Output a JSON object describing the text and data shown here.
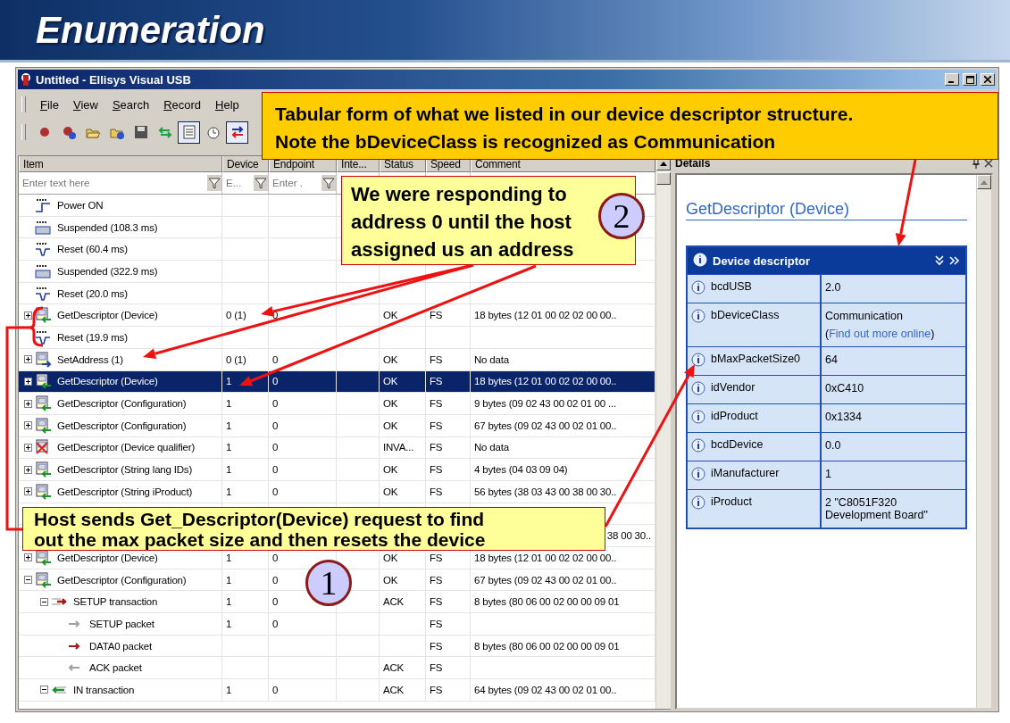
{
  "slide_title": "Enumeration",
  "window": {
    "title": "Untitled - Ellisys Visual USB"
  },
  "menu": [
    "File",
    "View",
    "Search",
    "Record",
    "Help"
  ],
  "toolbar": [
    {
      "kind": "record",
      "on": false
    },
    {
      "kind": "record-add",
      "on": false
    },
    {
      "kind": "open",
      "on": false
    },
    {
      "kind": "open-add",
      "on": false
    },
    {
      "kind": "save",
      "on": false
    },
    {
      "kind": "swap",
      "on": false
    },
    {
      "kind": "details",
      "on": true
    },
    {
      "kind": "clock",
      "on": false
    },
    {
      "kind": "exchange",
      "on": true
    }
  ],
  "table": {
    "columns": [
      "Item",
      "Device",
      "Endpoint",
      "Inte...",
      "Status",
      "Speed",
      "Comment"
    ],
    "filters": [
      {
        "placeholder": "Enter text here"
      },
      {
        "placeholder": "E..."
      },
      {
        "placeholder": "Enter ."
      }
    ],
    "rows": [
      {
        "kind": "power",
        "item": "Power ON",
        "selected": false
      },
      {
        "kind": "idle",
        "item": "Suspended (108.3 ms)",
        "selected": false
      },
      {
        "kind": "reset",
        "item": "Reset (60.4 ms)",
        "selected": false
      },
      {
        "kind": "idle",
        "item": "Suspended (322.9 ms)",
        "selected": false
      },
      {
        "kind": "reset",
        "item": "Reset (20.0 ms)",
        "selected": false
      },
      {
        "kind": "request",
        "item": "GetDescriptor (Device)",
        "device": "0 (1)",
        "endpoint": "0",
        "status": "OK",
        "speed": "FS",
        "comment": "18 bytes (12 01 00 02 02 00 00..",
        "expanded": false,
        "selected": false
      },
      {
        "kind": "reset",
        "item": "Reset (19.9 ms)",
        "selected": false
      },
      {
        "kind": "request-out",
        "item": "SetAddress (1)",
        "device": "0 (1)",
        "endpoint": "0",
        "status": "OK",
        "speed": "FS",
        "comment": "No data",
        "expanded": false,
        "selected": false
      },
      {
        "kind": "request",
        "item": "GetDescriptor (Device)",
        "device": "1",
        "endpoint": "0",
        "status": "OK",
        "speed": "FS",
        "comment": "18 bytes (12 01 00 02 02 00 00..",
        "expanded": false,
        "selected": true
      },
      {
        "kind": "request",
        "item": "GetDescriptor (Configuration)",
        "device": "1",
        "endpoint": "0",
        "status": "OK",
        "speed": "FS",
        "comment": "9 bytes (09 02 43 00 02 01 00 ...",
        "expanded": false,
        "selected": false
      },
      {
        "kind": "request",
        "item": "GetDescriptor (Configuration)",
        "device": "1",
        "endpoint": "0",
        "status": "OK",
        "speed": "FS",
        "comment": "67 bytes (09 02 43 00 02 01 00..",
        "expanded": false,
        "selected": false
      },
      {
        "kind": "request-error",
        "item": "GetDescriptor (Device qualifier)",
        "device": "1",
        "endpoint": "0",
        "status": "INVA...",
        "speed": "FS",
        "comment": "No data",
        "expanded": false,
        "selected": false
      },
      {
        "kind": "request",
        "item": "GetDescriptor (String lang IDs)",
        "device": "1",
        "endpoint": "0",
        "status": "OK",
        "speed": "FS",
        "comment": "4 bytes (04 03 09 04)",
        "expanded": false,
        "selected": false
      },
      {
        "kind": "request",
        "item": "GetDescriptor (String iProduct)",
        "device": "1",
        "endpoint": "0",
        "status": "OK",
        "speed": "FS",
        "comment": "56 bytes (38 03 43 00 38 00 30..",
        "expanded": false,
        "selected": false
      },
      {
        "kind": "covered"
      },
      {
        "kind": "covered",
        "comment": "38 00 30.."
      },
      {
        "kind": "request",
        "item": "GetDescriptor (Device)",
        "device": "1",
        "endpoint": "0",
        "status": "OK",
        "speed": "FS",
        "comment": "18 bytes (12 01 00 02 02 00 00..",
        "expanded": false,
        "selected": false
      },
      {
        "kind": "request",
        "item": "GetDescriptor (Configuration)",
        "device": "1",
        "endpoint": "0",
        "status": "OK",
        "speed": "FS",
        "comment": "67 bytes (09 02 43 00 02 01 00..",
        "expanded": true,
        "selected": false,
        "children": [
          {
            "kind": "setup",
            "item": "SETUP transaction",
            "device": "1",
            "endpoint": "0",
            "status": "ACK",
            "speed": "FS",
            "comment": "8 bytes (80 06 00 02 00 00 09 01",
            "expanded": true,
            "selected": false,
            "children": [
              {
                "kind": "packet-setup",
                "item": "SETUP packet",
                "device": "1",
                "endpoint": "0",
                "speed": "FS",
                "selected": false
              },
              {
                "kind": "packet-data",
                "item": "DATA0 packet",
                "speed": "FS",
                "comment": "8 bytes (80 06 00 02 00 00 09 01",
                "selected": false
              },
              {
                "kind": "packet-ack",
                "item": "ACK packet",
                "status": "ACK",
                "speed": "FS",
                "selected": false
              }
            ]
          },
          {
            "kind": "in",
            "item": "IN transaction",
            "device": "1",
            "endpoint": "0",
            "status": "ACK",
            "speed": "FS",
            "comment": "64 bytes (09 02 43 00 02 01 00..",
            "expanded": true,
            "selected": false
          }
        ]
      }
    ]
  },
  "details": {
    "title": "Details",
    "heading": "GetDescriptor (Device)",
    "descriptor_title": "Device descriptor",
    "fields": [
      {
        "name": "bcdUSB",
        "value": "2.0"
      },
      {
        "name": "bDeviceClass",
        "value": "Communication",
        "more_prefix": "(",
        "more_link": "Find out more online",
        "more_suffix": ")"
      },
      {
        "name": "bMaxPacketSize0",
        "value": "64"
      },
      {
        "name": "idVendor",
        "value": "0xC410"
      },
      {
        "name": "idProduct",
        "value": "0x1334"
      },
      {
        "name": "bcdDevice",
        "value": "0.0"
      },
      {
        "name": "iManufacturer",
        "value": "1"
      },
      {
        "name": "iProduct",
        "value": "2 \"C8051F320 Development Board\""
      }
    ]
  },
  "callouts": [
    {
      "text": "Tabular form of what we listed in our device descriptor structure.\nNote the bDeviceClass is recognized as Communication",
      "color": "#ffcc00"
    },
    {
      "text": "We were responding to\naddress 0 until the host\nassigned us an address",
      "color": "#ffff99"
    },
    {
      "text": "Host sends Get_Descriptor(Device) request to find\nout the max packet size and then resets the device",
      "color": "#ffff99"
    }
  ],
  "markers": [
    {
      "label": "2"
    },
    {
      "label": "1"
    }
  ]
}
